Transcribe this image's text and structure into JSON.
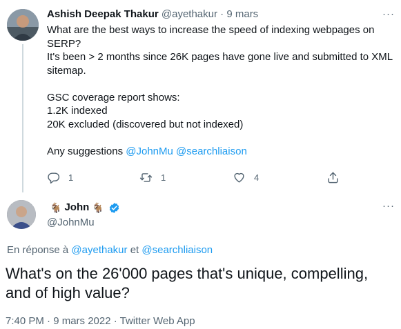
{
  "tweet1": {
    "author_name": "Ashish Deepak Thakur",
    "author_handle": "@ayethakur",
    "separator": "·",
    "date": "9 mars",
    "body_lines": [
      "What are the best ways to increase the speed of indexing webpages on",
      "SERP?",
      "It's been > 2 months since 26K pages have gone live and submitted to XML",
      "sitemap.",
      "",
      "GSC coverage report shows:",
      "1.2K indexed",
      "20K excluded (discovered but not indexed)",
      ""
    ],
    "suggestions_prefix": "Any suggestions",
    "mention_1": "@JohnMu",
    "mention_2": "@searchliaison",
    "reply_count": "1",
    "retweet_count": "1",
    "like_count": "4"
  },
  "tweet2": {
    "author_emoji_left": "🐐",
    "author_name": "John",
    "author_emoji_right": "🐐",
    "author_handle": "@JohnMu",
    "reply_prefix": "En réponse à",
    "reply_mention_1": "@ayethakur",
    "reply_joiner": "et",
    "reply_mention_2": "@searchliaison",
    "text_lines": [
      "What's on the 26'000 pages that's unique, compelling,",
      "and of high value?"
    ],
    "meta": "7:40 PM · 9 mars 2022 · Twitter Web App"
  },
  "more_label": "···",
  "icons": {
    "reply": "reply-icon",
    "retweet": "retweet-icon",
    "like": "heart-icon",
    "share": "share-icon",
    "verified": "verified-badge-icon"
  },
  "colors": {
    "text": "#0f1419",
    "muted": "#536471",
    "link": "#1d9bf0",
    "divider": "#cfd9de"
  }
}
